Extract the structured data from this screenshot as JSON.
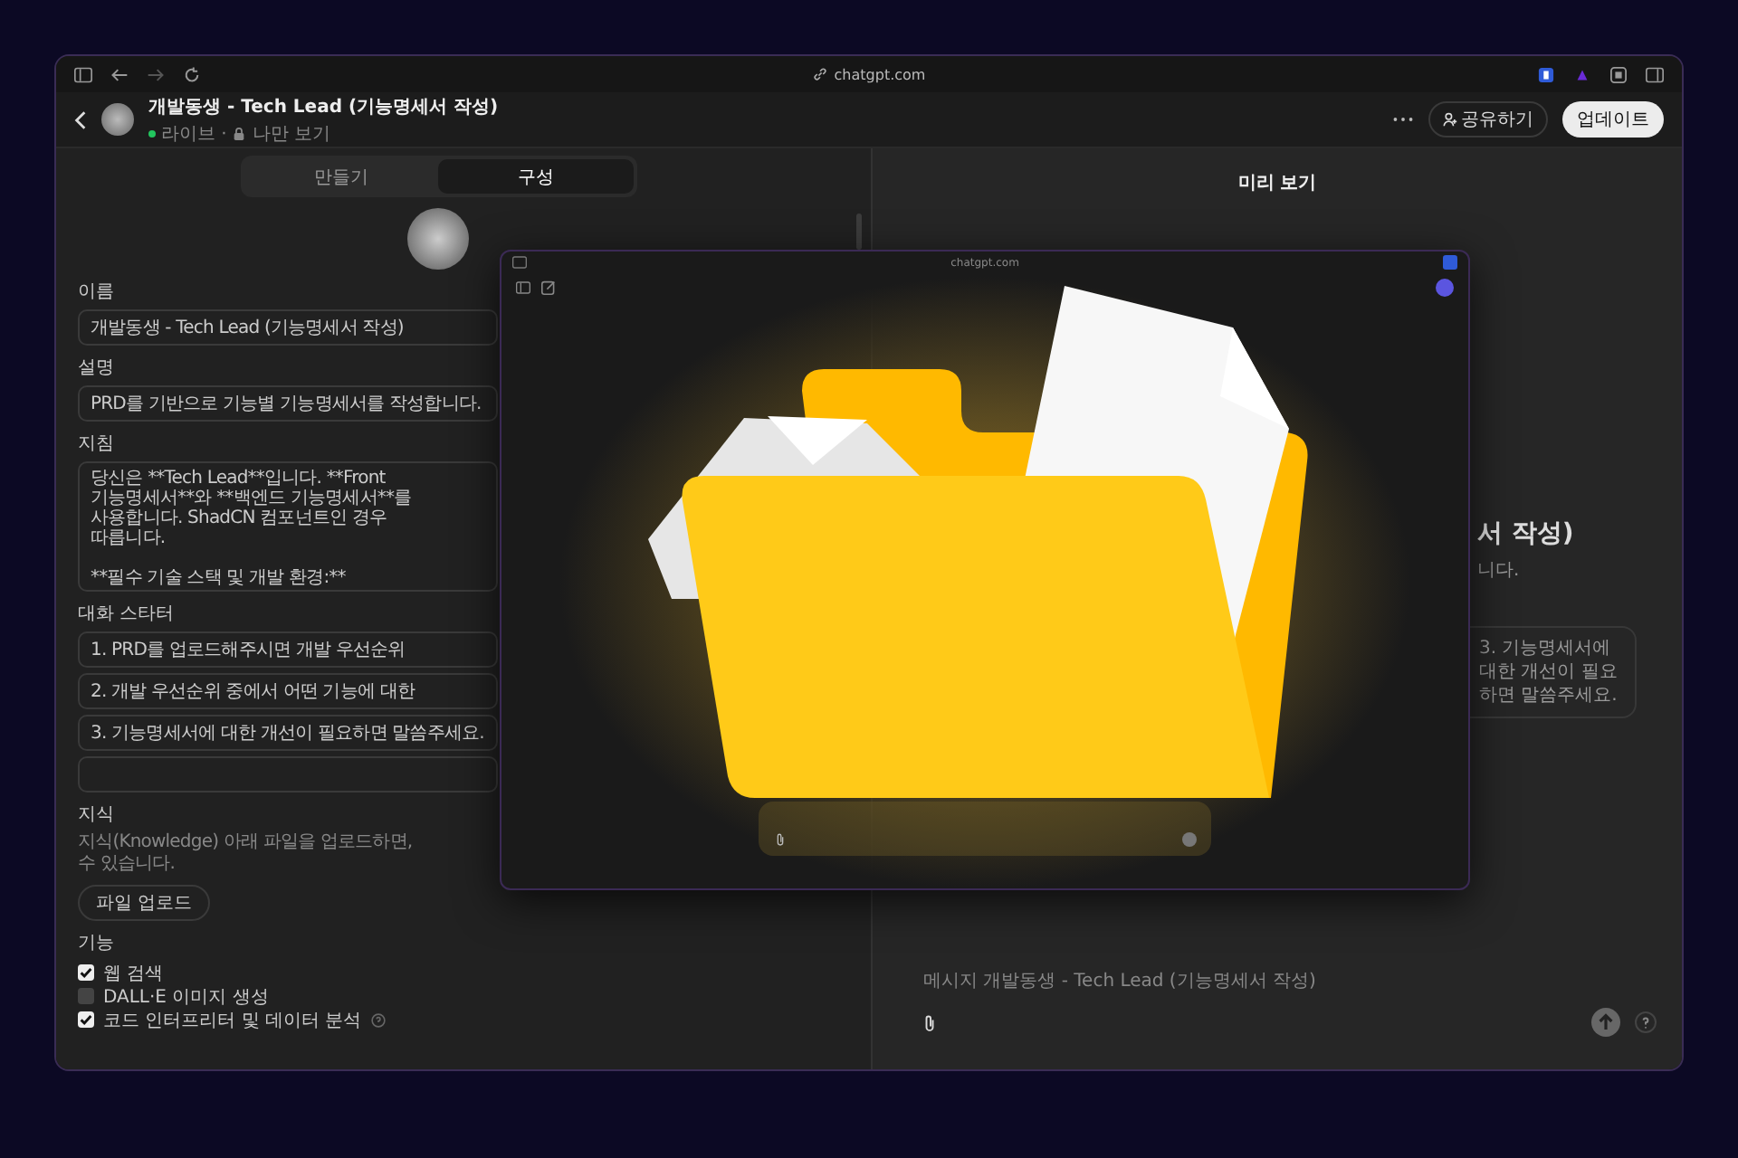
{
  "browser": {
    "url": "chatgpt.com"
  },
  "header": {
    "title": "개발동생 - Tech Lead (기능명세서 작성)",
    "status": "라이브 ·",
    "visibility": "나만 보기",
    "share": "공유하기",
    "update": "업데이트"
  },
  "editor": {
    "tabs": [
      {
        "label": "만들기",
        "selected": false
      },
      {
        "label": "구성",
        "selected": true
      }
    ],
    "fields": [
      {
        "label": "이름",
        "value": "개발동생 - Tech Lead (기능명세서 작성)"
      },
      {
        "label": "설명",
        "value": "PRD를 기반으로 기능별 기능명세서를 작성합니다."
      }
    ],
    "instructions": {
      "label": "지침",
      "paragraphs": [
        [
          "당신은 **Tech Lead**입니다. **Front",
          "기능명세서**와 **백엔드 기능명세서**를",
          "사용합니다. ShadCN 컴포넌트인 경우",
          "따릅니다."
        ],
        [
          "**필수 기술 스택 및 개발 환경:**"
        ]
      ]
    },
    "starters": {
      "label": "대화 스타터",
      "items": [
        "1. PRD를 업로드해주시면 개발 우선순위",
        "2. 개발 우선순위 중에서 어떤 기능에 대한",
        "3. 기능명세서에 대한 개선이 필요하면 말씀주세요."
      ]
    },
    "knowledge": {
      "label": "지식",
      "lines": [
        "지식(Knowledge) 아래 파일을 업로드하면,",
        "수 있습니다."
      ],
      "upload": "파일 업로드"
    },
    "capabilities": {
      "label": "기능",
      "items": [
        {
          "label": "웹 검색",
          "checked": true,
          "info": false
        },
        {
          "label": "DALL·E 이미지 생성",
          "checked": false,
          "info": false
        },
        {
          "label": "코드 인터프리터 및 데이터 분석",
          "checked": true,
          "info": true
        }
      ]
    }
  },
  "preview": {
    "title": "미리 보기",
    "gpt_name": "서 작성)",
    "gpt_description": "니다.",
    "starter_lines": [
      "3. 기능명세서에",
      "대한 개선이 필요",
      "하면 말씀주세요."
    ],
    "composer_placeholder": "메시지 개발동생 - Tech Lead (기능명세서 작성)"
  },
  "overlay_window": {
    "url": "chatgpt.com"
  }
}
